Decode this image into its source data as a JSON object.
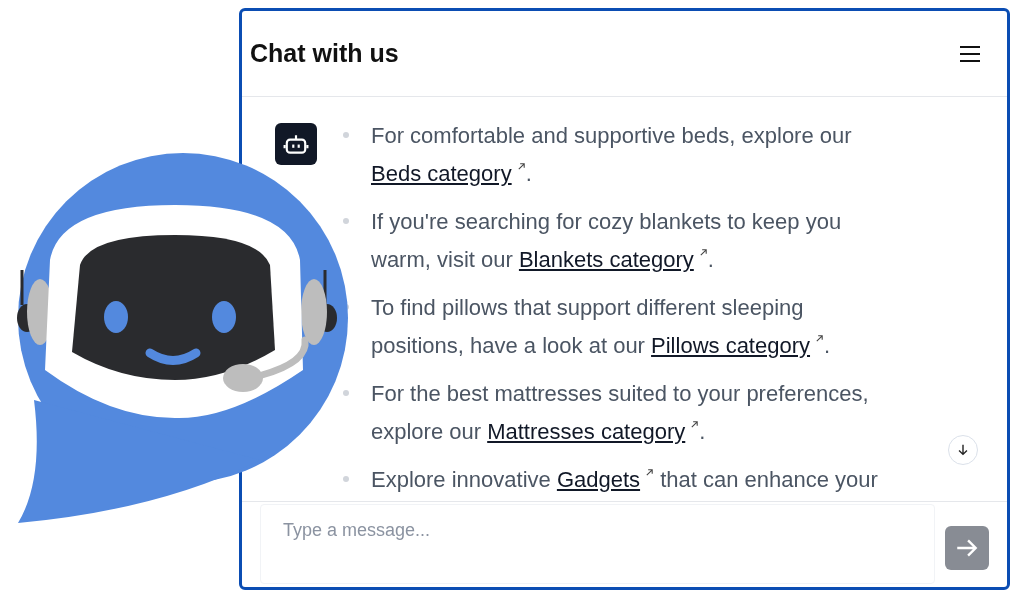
{
  "header": {
    "title": "Chat with us"
  },
  "messages": [
    {
      "parts": [
        {
          "kind": "text",
          "text": "For comfortable and supportive beds, explore our "
        },
        {
          "kind": "link",
          "text": "Beds category"
        },
        {
          "kind": "text",
          "text": "."
        }
      ]
    },
    {
      "parts": [
        {
          "kind": "text",
          "text": "If you're searching for cozy blankets to keep you warm, visit our "
        },
        {
          "kind": "link",
          "text": "Blankets category"
        },
        {
          "kind": "text",
          "text": "."
        }
      ]
    },
    {
      "parts": [
        {
          "kind": "text",
          "text": "To find pillows that support different sleeping positions, have a look at our "
        },
        {
          "kind": "link",
          "text": "Pillows category"
        },
        {
          "kind": "text",
          "text": "."
        }
      ]
    },
    {
      "parts": [
        {
          "kind": "text",
          "text": "For the best mattresses suited to your preferences, explore our "
        },
        {
          "kind": "link",
          "text": "Mattresses category"
        },
        {
          "kind": "text",
          "text": "."
        }
      ]
    },
    {
      "parts": [
        {
          "kind": "text",
          "text": "Explore innovative "
        },
        {
          "kind": "link",
          "text": "Gadgets"
        },
        {
          "kind": "text",
          "text": " that can enhance your"
        }
      ]
    }
  ],
  "composer": {
    "placeholder": "Type a message..."
  }
}
